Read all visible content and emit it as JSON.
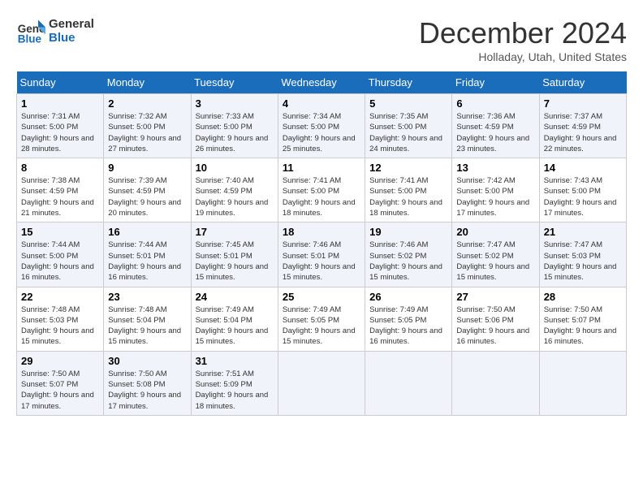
{
  "logo": {
    "line1": "General",
    "line2": "Blue"
  },
  "title": "December 2024",
  "subtitle": "Holladay, Utah, United States",
  "days_header": [
    "Sunday",
    "Monday",
    "Tuesday",
    "Wednesday",
    "Thursday",
    "Friday",
    "Saturday"
  ],
  "weeks": [
    [
      {
        "day": "1",
        "sunrise": "Sunrise: 7:31 AM",
        "sunset": "Sunset: 5:00 PM",
        "daylight": "Daylight: 9 hours and 28 minutes."
      },
      {
        "day": "2",
        "sunrise": "Sunrise: 7:32 AM",
        "sunset": "Sunset: 5:00 PM",
        "daylight": "Daylight: 9 hours and 27 minutes."
      },
      {
        "day": "3",
        "sunrise": "Sunrise: 7:33 AM",
        "sunset": "Sunset: 5:00 PM",
        "daylight": "Daylight: 9 hours and 26 minutes."
      },
      {
        "day": "4",
        "sunrise": "Sunrise: 7:34 AM",
        "sunset": "Sunset: 5:00 PM",
        "daylight": "Daylight: 9 hours and 25 minutes."
      },
      {
        "day": "5",
        "sunrise": "Sunrise: 7:35 AM",
        "sunset": "Sunset: 5:00 PM",
        "daylight": "Daylight: 9 hours and 24 minutes."
      },
      {
        "day": "6",
        "sunrise": "Sunrise: 7:36 AM",
        "sunset": "Sunset: 4:59 PM",
        "daylight": "Daylight: 9 hours and 23 minutes."
      },
      {
        "day": "7",
        "sunrise": "Sunrise: 7:37 AM",
        "sunset": "Sunset: 4:59 PM",
        "daylight": "Daylight: 9 hours and 22 minutes."
      }
    ],
    [
      {
        "day": "8",
        "sunrise": "Sunrise: 7:38 AM",
        "sunset": "Sunset: 4:59 PM",
        "daylight": "Daylight: 9 hours and 21 minutes."
      },
      {
        "day": "9",
        "sunrise": "Sunrise: 7:39 AM",
        "sunset": "Sunset: 4:59 PM",
        "daylight": "Daylight: 9 hours and 20 minutes."
      },
      {
        "day": "10",
        "sunrise": "Sunrise: 7:40 AM",
        "sunset": "Sunset: 4:59 PM",
        "daylight": "Daylight: 9 hours and 19 minutes."
      },
      {
        "day": "11",
        "sunrise": "Sunrise: 7:41 AM",
        "sunset": "Sunset: 5:00 PM",
        "daylight": "Daylight: 9 hours and 18 minutes."
      },
      {
        "day": "12",
        "sunrise": "Sunrise: 7:41 AM",
        "sunset": "Sunset: 5:00 PM",
        "daylight": "Daylight: 9 hours and 18 minutes."
      },
      {
        "day": "13",
        "sunrise": "Sunrise: 7:42 AM",
        "sunset": "Sunset: 5:00 PM",
        "daylight": "Daylight: 9 hours and 17 minutes."
      },
      {
        "day": "14",
        "sunrise": "Sunrise: 7:43 AM",
        "sunset": "Sunset: 5:00 PM",
        "daylight": "Daylight: 9 hours and 17 minutes."
      }
    ],
    [
      {
        "day": "15",
        "sunrise": "Sunrise: 7:44 AM",
        "sunset": "Sunset: 5:00 PM",
        "daylight": "Daylight: 9 hours and 16 minutes."
      },
      {
        "day": "16",
        "sunrise": "Sunrise: 7:44 AM",
        "sunset": "Sunset: 5:01 PM",
        "daylight": "Daylight: 9 hours and 16 minutes."
      },
      {
        "day": "17",
        "sunrise": "Sunrise: 7:45 AM",
        "sunset": "Sunset: 5:01 PM",
        "daylight": "Daylight: 9 hours and 15 minutes."
      },
      {
        "day": "18",
        "sunrise": "Sunrise: 7:46 AM",
        "sunset": "Sunset: 5:01 PM",
        "daylight": "Daylight: 9 hours and 15 minutes."
      },
      {
        "day": "19",
        "sunrise": "Sunrise: 7:46 AM",
        "sunset": "Sunset: 5:02 PM",
        "daylight": "Daylight: 9 hours and 15 minutes."
      },
      {
        "day": "20",
        "sunrise": "Sunrise: 7:47 AM",
        "sunset": "Sunset: 5:02 PM",
        "daylight": "Daylight: 9 hours and 15 minutes."
      },
      {
        "day": "21",
        "sunrise": "Sunrise: 7:47 AM",
        "sunset": "Sunset: 5:03 PM",
        "daylight": "Daylight: 9 hours and 15 minutes."
      }
    ],
    [
      {
        "day": "22",
        "sunrise": "Sunrise: 7:48 AM",
        "sunset": "Sunset: 5:03 PM",
        "daylight": "Daylight: 9 hours and 15 minutes."
      },
      {
        "day": "23",
        "sunrise": "Sunrise: 7:48 AM",
        "sunset": "Sunset: 5:04 PM",
        "daylight": "Daylight: 9 hours and 15 minutes."
      },
      {
        "day": "24",
        "sunrise": "Sunrise: 7:49 AM",
        "sunset": "Sunset: 5:04 PM",
        "daylight": "Daylight: 9 hours and 15 minutes."
      },
      {
        "day": "25",
        "sunrise": "Sunrise: 7:49 AM",
        "sunset": "Sunset: 5:05 PM",
        "daylight": "Daylight: 9 hours and 15 minutes."
      },
      {
        "day": "26",
        "sunrise": "Sunrise: 7:49 AM",
        "sunset": "Sunset: 5:05 PM",
        "daylight": "Daylight: 9 hours and 16 minutes."
      },
      {
        "day": "27",
        "sunrise": "Sunrise: 7:50 AM",
        "sunset": "Sunset: 5:06 PM",
        "daylight": "Daylight: 9 hours and 16 minutes."
      },
      {
        "day": "28",
        "sunrise": "Sunrise: 7:50 AM",
        "sunset": "Sunset: 5:07 PM",
        "daylight": "Daylight: 9 hours and 16 minutes."
      }
    ],
    [
      {
        "day": "29",
        "sunrise": "Sunrise: 7:50 AM",
        "sunset": "Sunset: 5:07 PM",
        "daylight": "Daylight: 9 hours and 17 minutes."
      },
      {
        "day": "30",
        "sunrise": "Sunrise: 7:50 AM",
        "sunset": "Sunset: 5:08 PM",
        "daylight": "Daylight: 9 hours and 17 minutes."
      },
      {
        "day": "31",
        "sunrise": "Sunrise: 7:51 AM",
        "sunset": "Sunset: 5:09 PM",
        "daylight": "Daylight: 9 hours and 18 minutes."
      },
      null,
      null,
      null,
      null
    ]
  ]
}
